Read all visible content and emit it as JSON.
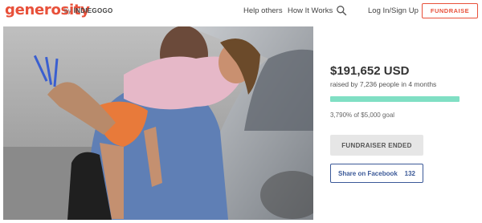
{
  "header": {
    "logo": "generosity",
    "by_text": "by",
    "by_brand": "INDIEGOGO",
    "nav": {
      "help_others": "Help others",
      "how_it_works": "How It Works",
      "login": "Log In/Sign Up"
    },
    "search_icon": "search-icon",
    "fundraise_label": "FUNDRAISE"
  },
  "campaign": {
    "amount": "$191,652 USD",
    "raised_by": "raised by 7,236 people in 4 months",
    "progress_fraction": 1.0,
    "goal_text": "3,790% of $5,000 goal",
    "ended_label": "FUNDRAISER ENDED",
    "share_label": "Share on Facebook",
    "share_count": "132"
  },
  "colors": {
    "brand": "#e8503a",
    "progress": "#80dfc4",
    "facebook": "#3b5998"
  }
}
